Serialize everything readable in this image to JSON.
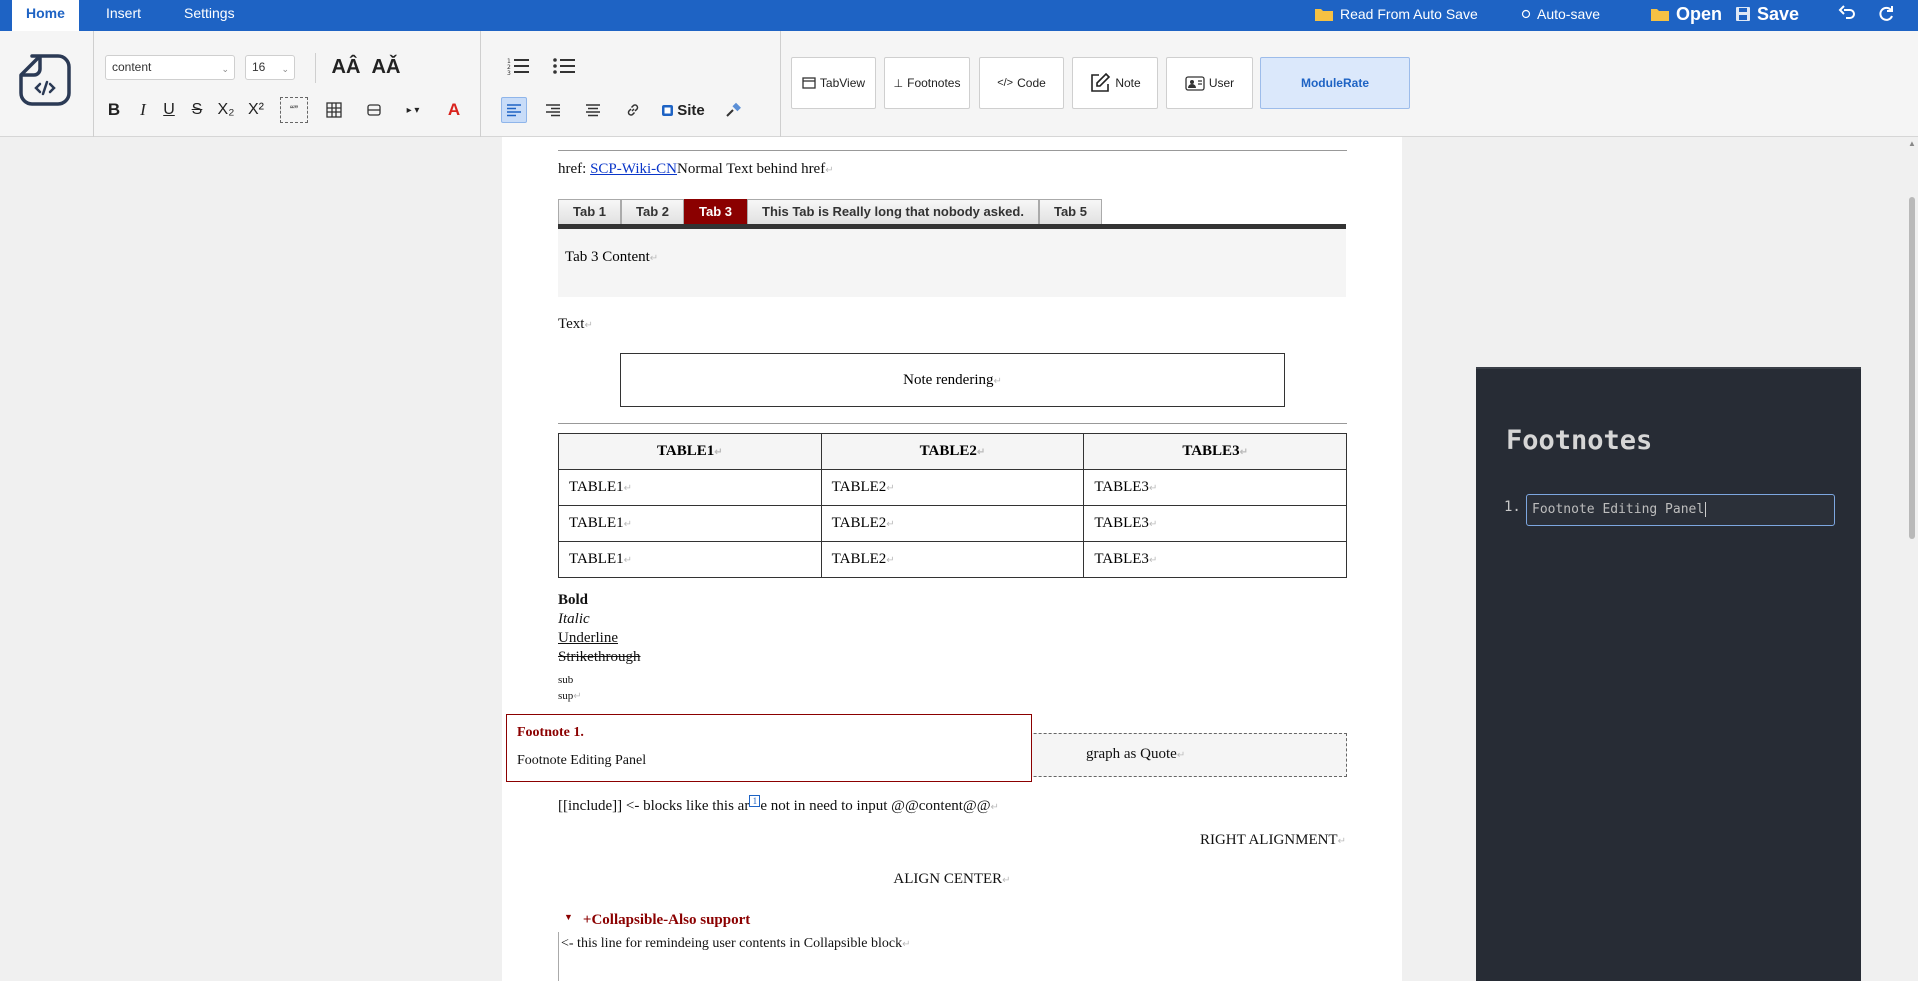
{
  "menubar": {
    "tabs": [
      {
        "label": "Home",
        "active": true
      },
      {
        "label": "Insert",
        "active": false
      },
      {
        "label": "Settings",
        "active": false
      }
    ],
    "read_autosave": "Read From Auto Save",
    "autosave": "Auto-save",
    "open": "Open",
    "save": "Save"
  },
  "ribbon": {
    "font_name": "content",
    "font_size": "16",
    "site_label": "Site",
    "modules": [
      "TabView",
      "Footnotes",
      "Code",
      "Note",
      "User",
      "ModuleRate"
    ]
  },
  "doc": {
    "href_prefix": "href: ",
    "href_link": "SCP-Wiki-CN",
    "href_suffix": "Normal Text behind href",
    "tabs": [
      "Tab 1",
      "Tab 2",
      "Tab 3",
      "This Tab is Really long that nobody asked.",
      "Tab 5"
    ],
    "active_tab_index": 2,
    "tab_content": "Tab 3 Content",
    "text": "Text",
    "note": "Note rendering",
    "table": {
      "headers": [
        "TABLE1",
        "TABLE2",
        "TABLE3"
      ],
      "rows": [
        [
          "TABLE1",
          "TABLE2",
          "TABLE3"
        ],
        [
          "TABLE1",
          "TABLE2",
          "TABLE3"
        ],
        [
          "TABLE1",
          "TABLE2",
          "TABLE3"
        ]
      ]
    },
    "bold": "Bold",
    "italic": "Italic",
    "underline": "Underline",
    "strike": "Strikethrough",
    "sub": "sub",
    "sup": "sup",
    "quote": "graph as Quote",
    "include_a": "[[include]] <- blocks like this ar",
    "include_marker": "1",
    "include_b": "e not in need to input @@content@@",
    "right_align": "RIGHT ALIGNMENT",
    "center_align": "ALIGN CENTER",
    "collapsible": "+Collapsible-Also support",
    "collapsible_body": "<- this line for remindeing user contents in Collapsible block"
  },
  "footnote_popup": {
    "heading": "Footnote 1.",
    "body": "Footnote Editing Panel"
  },
  "footnote_panel": {
    "title": "Footnotes",
    "number": "1.",
    "value": "Footnote Editing Panel"
  },
  "colors": {
    "brand": "#1e63c4",
    "tab_active": "#8b0000",
    "panel_bg": "#272c35"
  }
}
